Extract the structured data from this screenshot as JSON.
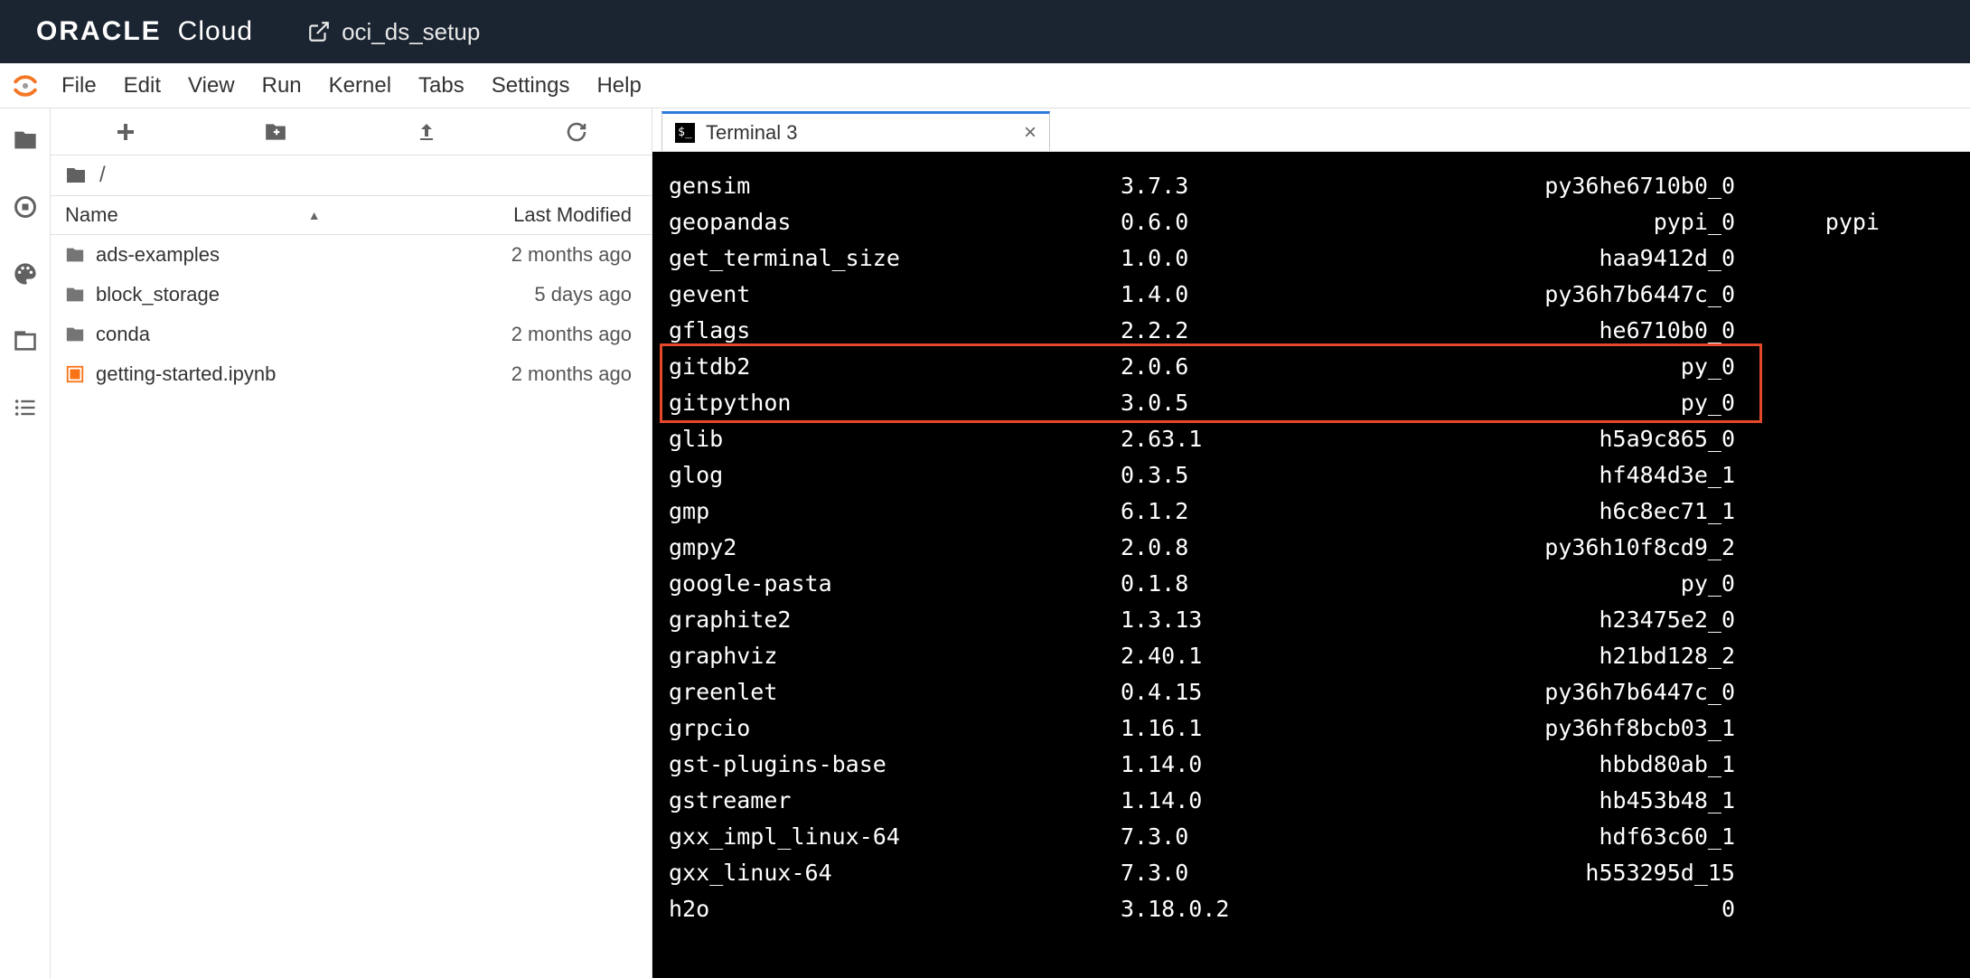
{
  "header": {
    "brand_oracle": "ORACLE",
    "brand_cloud": "Cloud",
    "project_name": "oci_ds_setup"
  },
  "menubar": {
    "items": [
      "File",
      "Edit",
      "View",
      "Run",
      "Kernel",
      "Tabs",
      "Settings",
      "Help"
    ]
  },
  "filebrowser": {
    "breadcrumb_root": "/",
    "header_name": "Name",
    "header_modified": "Last Modified",
    "rows": [
      {
        "type": "folder",
        "name": "ads-examples",
        "modified": "2 months ago"
      },
      {
        "type": "folder",
        "name": "block_storage",
        "modified": "5 days ago"
      },
      {
        "type": "folder",
        "name": "conda",
        "modified": "2 months ago"
      },
      {
        "type": "notebook",
        "name": "getting-started.ipynb",
        "modified": "2 months ago"
      }
    ]
  },
  "tab": {
    "title": "Terminal 3"
  },
  "terminal": {
    "highlight_rows": [
      5,
      6
    ],
    "packages": [
      {
        "name": "gensim",
        "version": "3.7.3",
        "build": "py36he6710b0_0",
        "channel": ""
      },
      {
        "name": "geopandas",
        "version": "0.6.0",
        "build": "pypi_0",
        "channel": "pypi"
      },
      {
        "name": "get_terminal_size",
        "version": "1.0.0",
        "build": "haa9412d_0",
        "channel": ""
      },
      {
        "name": "gevent",
        "version": "1.4.0",
        "build": "py36h7b6447c_0",
        "channel": ""
      },
      {
        "name": "gflags",
        "version": "2.2.2",
        "build": "he6710b0_0",
        "channel": ""
      },
      {
        "name": "gitdb2",
        "version": "2.0.6",
        "build": "py_0",
        "channel": ""
      },
      {
        "name": "gitpython",
        "version": "3.0.5",
        "build": "py_0",
        "channel": ""
      },
      {
        "name": "glib",
        "version": "2.63.1",
        "build": "h5a9c865_0",
        "channel": ""
      },
      {
        "name": "glog",
        "version": "0.3.5",
        "build": "hf484d3e_1",
        "channel": ""
      },
      {
        "name": "gmp",
        "version": "6.1.2",
        "build": "h6c8ec71_1",
        "channel": ""
      },
      {
        "name": "gmpy2",
        "version": "2.0.8",
        "build": "py36h10f8cd9_2",
        "channel": ""
      },
      {
        "name": "google-pasta",
        "version": "0.1.8",
        "build": "py_0",
        "channel": ""
      },
      {
        "name": "graphite2",
        "version": "1.3.13",
        "build": "h23475e2_0",
        "channel": ""
      },
      {
        "name": "graphviz",
        "version": "2.40.1",
        "build": "h21bd128_2",
        "channel": ""
      },
      {
        "name": "greenlet",
        "version": "0.4.15",
        "build": "py36h7b6447c_0",
        "channel": ""
      },
      {
        "name": "grpcio",
        "version": "1.16.1",
        "build": "py36hf8bcb03_1",
        "channel": ""
      },
      {
        "name": "gst-plugins-base",
        "version": "1.14.0",
        "build": "hbbd80ab_1",
        "channel": ""
      },
      {
        "name": "gstreamer",
        "version": "1.14.0",
        "build": "hb453b48_1",
        "channel": ""
      },
      {
        "name": "gxx_impl_linux-64",
        "version": "7.3.0",
        "build": "hdf63c60_1",
        "channel": ""
      },
      {
        "name": "gxx_linux-64",
        "version": "7.3.0",
        "build": "h553295d_15",
        "channel": ""
      },
      {
        "name": "h2o",
        "version": "3.18.0.2",
        "build": "0",
        "channel": ""
      }
    ]
  }
}
